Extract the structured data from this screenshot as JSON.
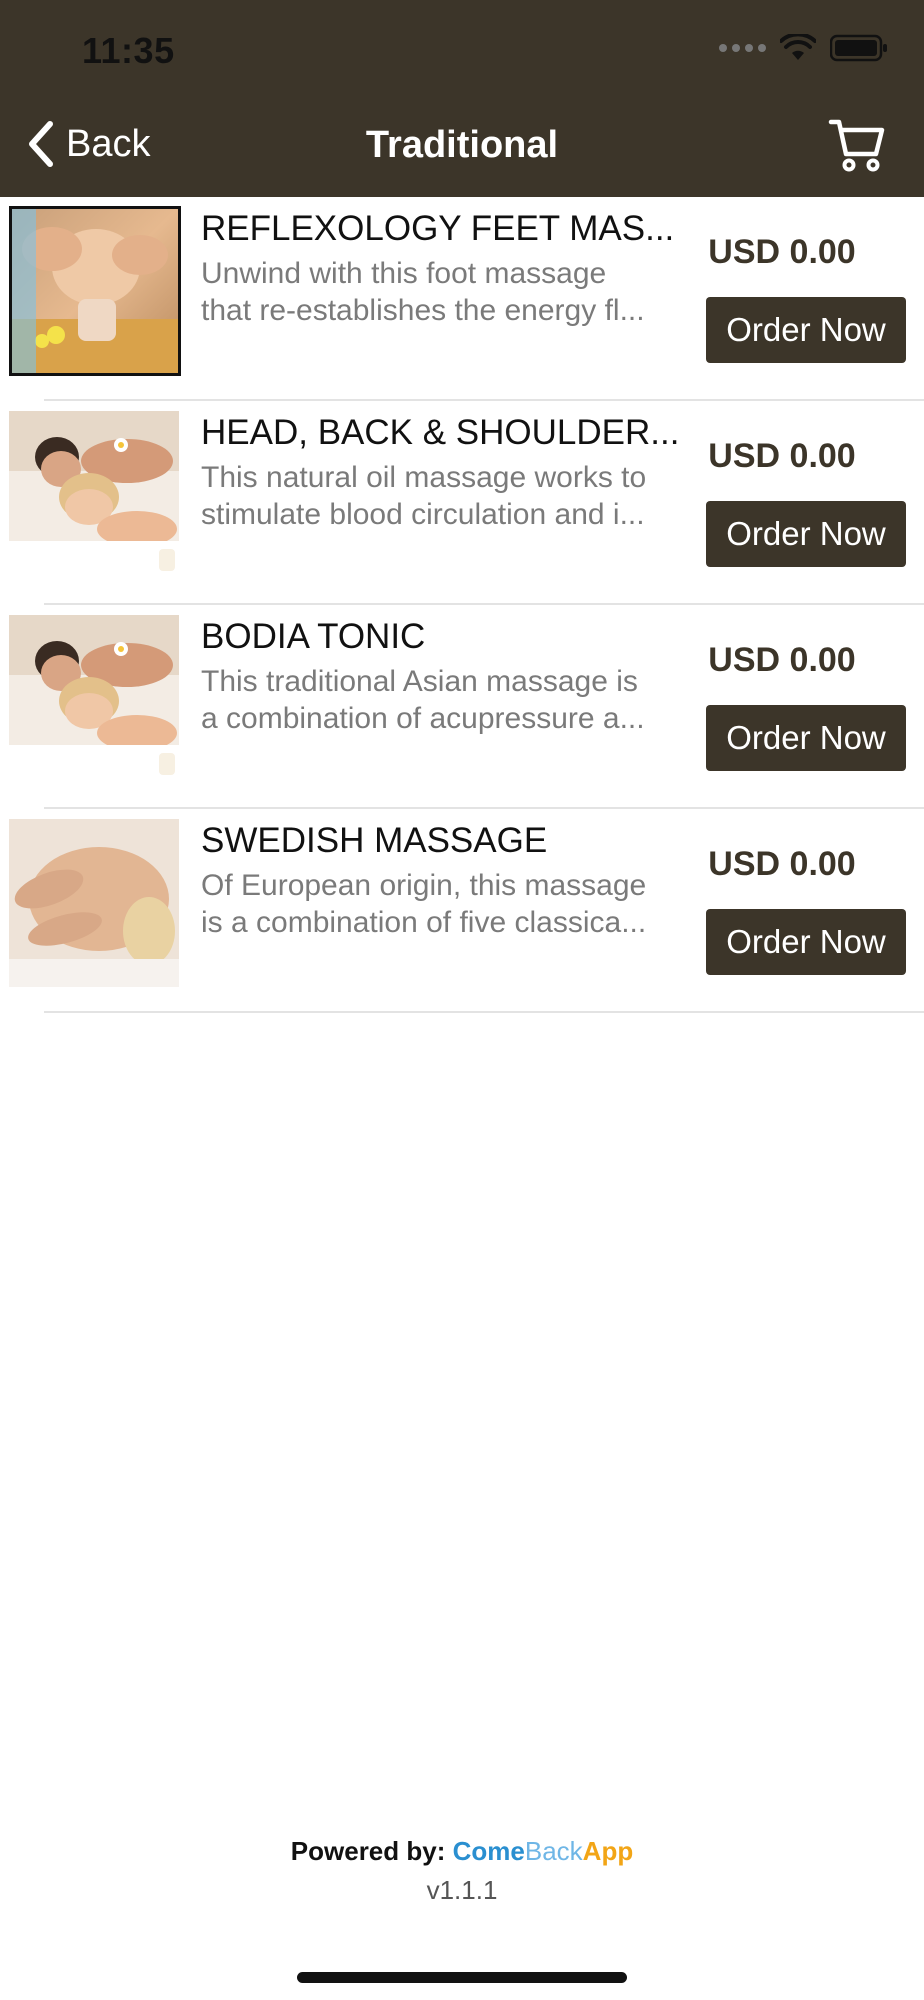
{
  "status_bar": {
    "time": "11:35"
  },
  "nav": {
    "back_label": "Back",
    "title": "Traditional",
    "cart_icon": "cart-icon"
  },
  "items": [
    {
      "title": "REFLEXOLOGY FEET MAS...",
      "desc_line1": "Unwind with this foot massage",
      "desc_line2": "that re-establishes the energy fl...",
      "price": "USD 0.00",
      "button": "Order Now"
    },
    {
      "title": "HEAD, BACK & SHOULDER...",
      "desc_line1": "This natural oil massage works to",
      "desc_line2": "stimulate blood circulation and i...",
      "price": "USD 0.00",
      "button": "Order Now"
    },
    {
      "title": "BODIA TONIC",
      "desc_line1": "This traditional Asian massage is",
      "desc_line2": "a combination of acupressure a...",
      "price": "USD 0.00",
      "button": "Order Now"
    },
    {
      "title": "SWEDISH MASSAGE",
      "desc_line1": "Of European origin, this massage",
      "desc_line2": "is a combination of five classica...",
      "price": "USD 0.00",
      "button": "Order Now"
    }
  ],
  "footer": {
    "powered_by": "Powered by:",
    "brand_come": "Come",
    "brand_back": "Back",
    "brand_app": "App",
    "version": "v1.1.1"
  },
  "colors": {
    "header_bg": "#3c3529",
    "button_bg": "#3c3529",
    "price_color": "#3c3529"
  }
}
